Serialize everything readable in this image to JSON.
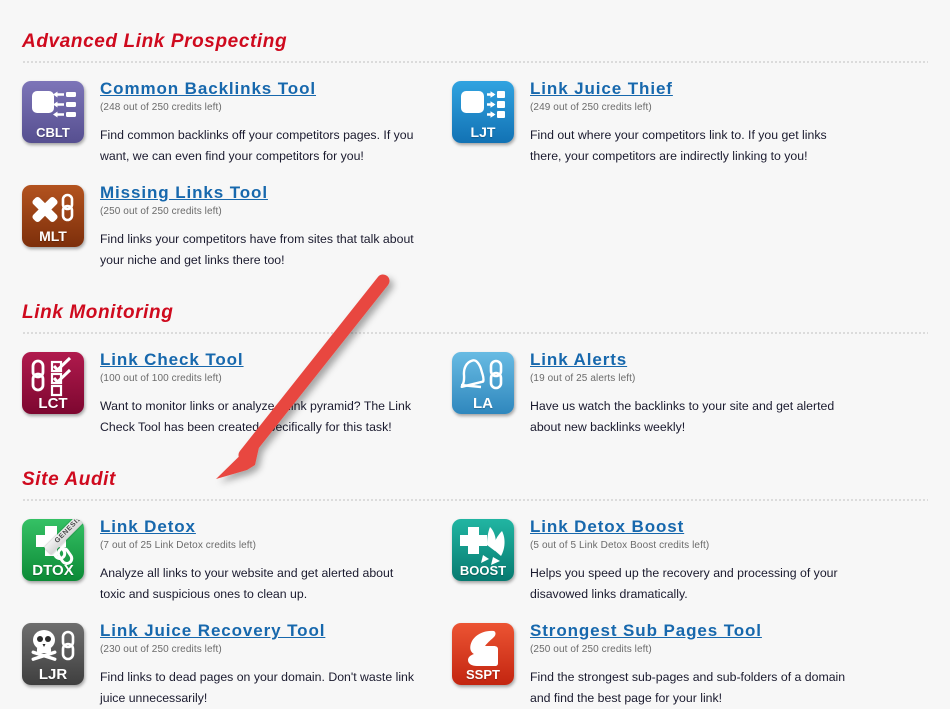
{
  "page": {
    "background_color": "#f7f7f7",
    "section_title_color": "#cf0a1e",
    "link_color": "#1768ad",
    "annotation_arrow_color": "#e8473f"
  },
  "sections": [
    {
      "title": "Advanced Link Prospecting",
      "tools": [
        {
          "name": "Common Backlinks Tool",
          "abbr": "CBLT",
          "icon": "common-backlinks-icon",
          "color": "#6b63a8",
          "credits": "(248 out of 250 credits left)",
          "description": "Find common backlinks off your competitors pages. If you want, we can even find your competitors for you!"
        },
        {
          "name": "Link Juice Thief",
          "abbr": "LJT",
          "icon": "link-juice-thief-icon",
          "color": "#1f8fd4",
          "credits": "(249 out of 250 credits left)",
          "description": "Find out where your competitors link to. If you get links there, your competitors are indirectly linking to you!"
        },
        {
          "name": "Missing Links Tool",
          "abbr": "MLT",
          "icon": "missing-links-icon",
          "color": "#9c3f18",
          "credits": "(250 out of 250 credits left)",
          "description": "Find links your competitors have from sites that talk about your niche and get links there too!"
        }
      ]
    },
    {
      "title": "Link Monitoring",
      "tools": [
        {
          "name": "Link Check Tool",
          "abbr": "LCT",
          "icon": "link-check-icon",
          "color": "#9d1040",
          "credits": "(100 out of 100 credits left)",
          "description": "Want to monitor links or analyze a link pyramid? The Link Check Tool has been created specifically for this task!"
        },
        {
          "name": "Link Alerts",
          "abbr": "LA",
          "icon": "link-alerts-icon",
          "color": "#4ba6d6",
          "credits": "(19 out of 25 alerts left)",
          "description": "Have us watch the backlinks to your site and get alerted about new backlinks weekly!"
        }
      ]
    },
    {
      "title": "Site Audit",
      "tools": [
        {
          "name": "Link Detox",
          "abbr": "DTOX",
          "icon": "link-detox-icon",
          "color": "#17a84a",
          "ribbon": "GENESIS",
          "credits": "(7 out of 25 Link Detox credits left)",
          "description": "Analyze all links to your website and get alerted about toxic and suspicious ones to clean up."
        },
        {
          "name": "Link Detox Boost",
          "abbr": "BOOST",
          "icon": "link-detox-boost-icon",
          "color": "#119b8b",
          "credits": "(5 out of 5 Link Detox Boost credits left)",
          "description": "Helps you speed up the recovery and processing of your disavowed links dramatically."
        },
        {
          "name": "Link Juice Recovery Tool",
          "abbr": "LJR",
          "icon": "link-juice-recovery-icon",
          "color": "#5a5a5a",
          "credits": "(230 out of 250 credits left)",
          "description": "Find links to dead pages on your domain. Don't waste link juice unnecessarily!"
        },
        {
          "name": "Strongest Sub Pages Tool",
          "abbr": "SSPT",
          "icon": "strongest-sub-pages-icon",
          "color": "#e03b22",
          "credits": "(250 out of 250 credits left)",
          "description": "Find the strongest sub-pages and sub-folders of a domain and find the best page for your link!"
        }
      ]
    }
  ]
}
